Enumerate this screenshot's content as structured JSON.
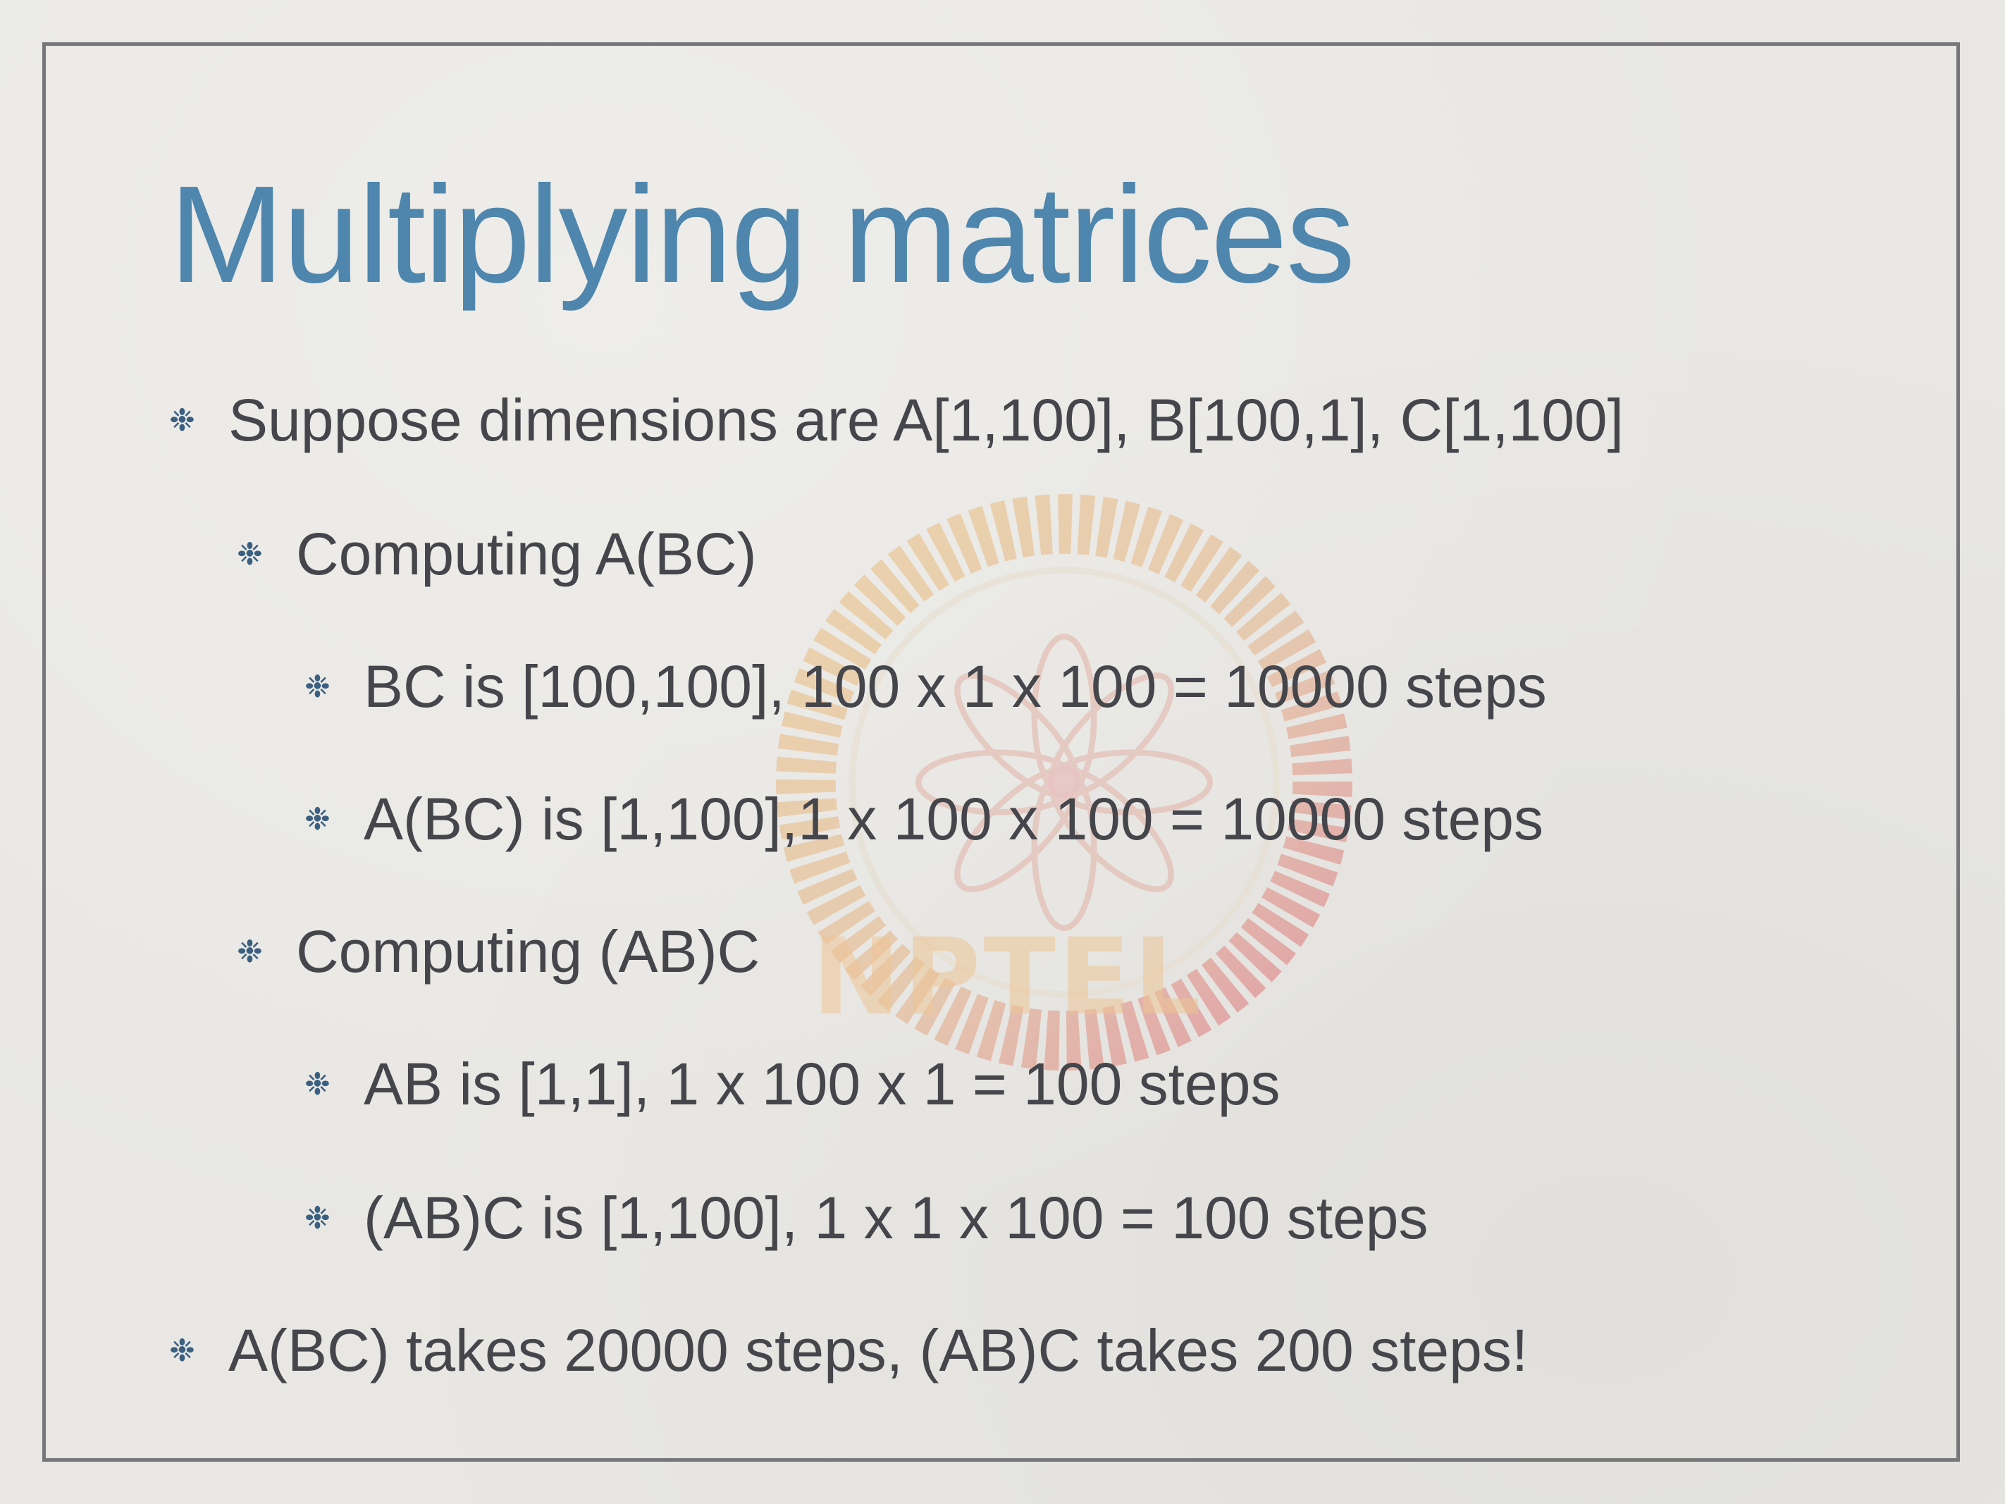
{
  "slide": {
    "title": "Multiplying matrices",
    "bullet_glyph": "❉",
    "watermark_text": "NPTEL",
    "bullets": [
      {
        "level": 1,
        "text": "Suppose dimensions are A[1,100], B[100,1], C[1,100]"
      },
      {
        "level": 2,
        "text": "Computing A(BC)"
      },
      {
        "level": 3,
        "text": "BC is [100,100], 100 x 1 x 100 = 10000 steps"
      },
      {
        "level": 3,
        "text": "A(BC) is [1,100],1 x 100 x 100 = 10000 steps"
      },
      {
        "level": 2,
        "text": "Computing (AB)C"
      },
      {
        "level": 3,
        "text": "AB is [1,1], 1 x 100 x 1 = 100 steps"
      },
      {
        "level": 3,
        "text": "(AB)C is [1,100], 1 x 1 x 100 = 100 steps"
      },
      {
        "level": 1,
        "text": "A(BC) takes 20000 steps, (AB)C takes 200 steps!"
      }
    ]
  },
  "colors": {
    "title": "#4e86ad",
    "body_text": "#45464b",
    "bullet_mark": "#3b5f80",
    "frame": "#77777a",
    "background": "#e8e7e3"
  }
}
